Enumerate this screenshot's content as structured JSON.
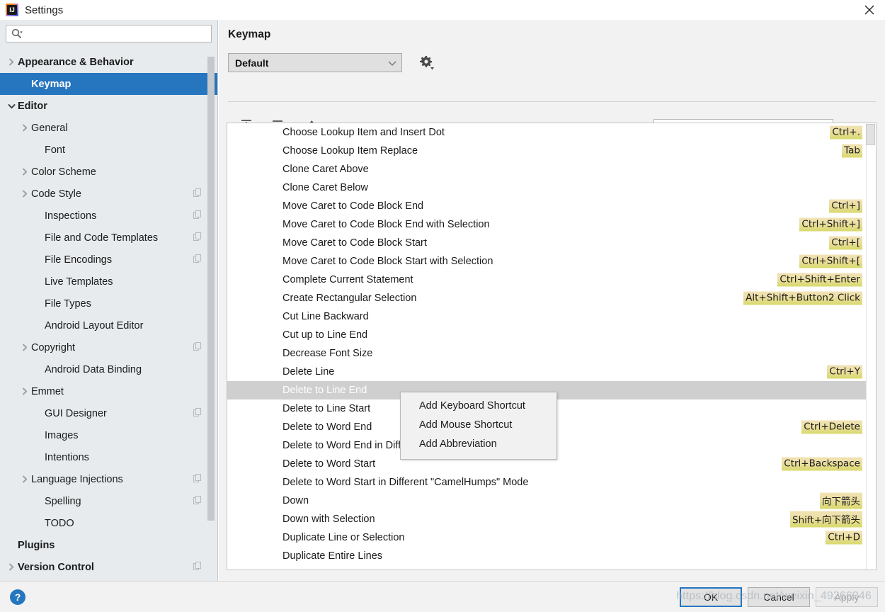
{
  "window": {
    "title": "Settings",
    "app_icon": "intellij-idea-icon",
    "close_icon": "close-icon"
  },
  "sidebar": {
    "search": {
      "placeholder": "",
      "value": "",
      "icon": "search-icon"
    },
    "items": [
      {
        "label": "Appearance & Behavior",
        "indent": 0,
        "arrow": "right",
        "bold": true,
        "badge": false,
        "selected": false
      },
      {
        "label": "Keymap",
        "indent": 1,
        "arrow": "none",
        "bold": true,
        "badge": false,
        "selected": true
      },
      {
        "label": "Editor",
        "indent": 0,
        "arrow": "down",
        "bold": true,
        "badge": false,
        "selected": false
      },
      {
        "label": "General",
        "indent": 1,
        "arrow": "right",
        "bold": false,
        "badge": false,
        "selected": false
      },
      {
        "label": "Font",
        "indent": 2,
        "arrow": "none",
        "bold": false,
        "badge": false,
        "selected": false
      },
      {
        "label": "Color Scheme",
        "indent": 1,
        "arrow": "right",
        "bold": false,
        "badge": false,
        "selected": false
      },
      {
        "label": "Code Style",
        "indent": 1,
        "arrow": "right",
        "bold": false,
        "badge": true,
        "selected": false
      },
      {
        "label": "Inspections",
        "indent": 2,
        "arrow": "none",
        "bold": false,
        "badge": true,
        "selected": false
      },
      {
        "label": "File and Code Templates",
        "indent": 2,
        "arrow": "none",
        "bold": false,
        "badge": true,
        "selected": false
      },
      {
        "label": "File Encodings",
        "indent": 2,
        "arrow": "none",
        "bold": false,
        "badge": true,
        "selected": false
      },
      {
        "label": "Live Templates",
        "indent": 2,
        "arrow": "none",
        "bold": false,
        "badge": false,
        "selected": false
      },
      {
        "label": "File Types",
        "indent": 2,
        "arrow": "none",
        "bold": false,
        "badge": false,
        "selected": false
      },
      {
        "label": "Android Layout Editor",
        "indent": 2,
        "arrow": "none",
        "bold": false,
        "badge": false,
        "selected": false
      },
      {
        "label": "Copyright",
        "indent": 1,
        "arrow": "right",
        "bold": false,
        "badge": true,
        "selected": false
      },
      {
        "label": "Android Data Binding",
        "indent": 2,
        "arrow": "none",
        "bold": false,
        "badge": false,
        "selected": false
      },
      {
        "label": "Emmet",
        "indent": 1,
        "arrow": "right",
        "bold": false,
        "badge": false,
        "selected": false
      },
      {
        "label": "GUI Designer",
        "indent": 2,
        "arrow": "none",
        "bold": false,
        "badge": true,
        "selected": false
      },
      {
        "label": "Images",
        "indent": 2,
        "arrow": "none",
        "bold": false,
        "badge": false,
        "selected": false
      },
      {
        "label": "Intentions",
        "indent": 2,
        "arrow": "none",
        "bold": false,
        "badge": false,
        "selected": false
      },
      {
        "label": "Language Injections",
        "indent": 1,
        "arrow": "right",
        "bold": false,
        "badge": true,
        "selected": false
      },
      {
        "label": "Spelling",
        "indent": 2,
        "arrow": "none",
        "bold": false,
        "badge": true,
        "selected": false
      },
      {
        "label": "TODO",
        "indent": 2,
        "arrow": "none",
        "bold": false,
        "badge": false,
        "selected": false
      },
      {
        "label": "Plugins",
        "indent": 0,
        "arrow": "none",
        "bold": true,
        "badge": false,
        "selected": false
      },
      {
        "label": "Version Control",
        "indent": 0,
        "arrow": "right",
        "bold": true,
        "badge": true,
        "selected": false
      }
    ]
  },
  "panel": {
    "title": "Keymap",
    "keymap_select": {
      "value": "Default",
      "icon": "chevron-down-icon"
    },
    "gear_icon": "gear-settings-icon",
    "toolbar": [
      {
        "name": "expand-all-icon",
        "label": "Expand All"
      },
      {
        "name": "collapse-all-icon",
        "label": "Collapse All"
      },
      {
        "name": "edit-pencil-icon",
        "label": "Edit Shortcut"
      }
    ],
    "find_action": {
      "placeholder": "",
      "value": "",
      "icon": "search-icon"
    },
    "find_shortcut_icon": "find-by-shortcut-icon"
  },
  "actions": [
    {
      "name": "Choose Lookup Item and Insert Dot",
      "shortcut": "Ctrl+.",
      "selected": false
    },
    {
      "name": "Choose Lookup Item Replace",
      "shortcut": "Tab",
      "selected": false
    },
    {
      "name": "Clone Caret Above",
      "shortcut": "",
      "selected": false
    },
    {
      "name": "Clone Caret Below",
      "shortcut": "",
      "selected": false
    },
    {
      "name": "Move Caret to Code Block End",
      "shortcut": "Ctrl+]",
      "selected": false
    },
    {
      "name": "Move Caret to Code Block End with Selection",
      "shortcut": "Ctrl+Shift+]",
      "selected": false
    },
    {
      "name": "Move Caret to Code Block Start",
      "shortcut": "Ctrl+[",
      "selected": false
    },
    {
      "name": "Move Caret to Code Block Start with Selection",
      "shortcut": "Ctrl+Shift+[",
      "selected": false
    },
    {
      "name": "Complete Current Statement",
      "shortcut": "Ctrl+Shift+Enter",
      "selected": false
    },
    {
      "name": "Create Rectangular Selection",
      "shortcut": "Alt+Shift+Button2 Click",
      "selected": false
    },
    {
      "name": "Cut Line Backward",
      "shortcut": "",
      "selected": false
    },
    {
      "name": "Cut up to Line End",
      "shortcut": "",
      "selected": false
    },
    {
      "name": "Decrease Font Size",
      "shortcut": "",
      "selected": false
    },
    {
      "name": "Delete Line",
      "shortcut": "Ctrl+Y",
      "selected": false
    },
    {
      "name": "Delete to Line End",
      "shortcut": "",
      "selected": true
    },
    {
      "name": "Delete to Line Start",
      "shortcut": "",
      "selected": false
    },
    {
      "name": "Delete to Word End",
      "shortcut": "Ctrl+Delete",
      "selected": false
    },
    {
      "name": "Delete to Word End in Different \"CamelHumps\" Mode",
      "shortcut": "",
      "selected": false
    },
    {
      "name": "Delete to Word Start",
      "shortcut": "Ctrl+Backspace",
      "selected": false
    },
    {
      "name": "Delete to Word Start in Different \"CamelHumps\" Mode",
      "shortcut": "",
      "selected": false
    },
    {
      "name": "Down",
      "shortcut": "向下箭头",
      "selected": false
    },
    {
      "name": "Down with Selection",
      "shortcut": "Shift+向下箭头",
      "selected": false
    },
    {
      "name": "Duplicate Line or Selection",
      "shortcut": "Ctrl+D",
      "selected": false
    },
    {
      "name": "Duplicate Entire Lines",
      "shortcut": "",
      "selected": false
    }
  ],
  "context_menu": {
    "items": [
      {
        "label": "Add Keyboard Shortcut"
      },
      {
        "label": "Add Mouse Shortcut"
      },
      {
        "label": "Add Abbreviation"
      }
    ]
  },
  "footer": {
    "help_label": "?",
    "ok_label": "OK",
    "cancel_label": "Cancel",
    "apply_label": "Apply"
  },
  "watermark": {
    "text": "https://blog.csdn.net/weixin_49266346"
  },
  "colors": {
    "accent": "#2675bf",
    "sidebar_bg": "#e7ebee",
    "panel_bg": "#f2f2f2",
    "shortcut_highlight": "#dcd96e",
    "row_selected": "#cfcfcf"
  }
}
